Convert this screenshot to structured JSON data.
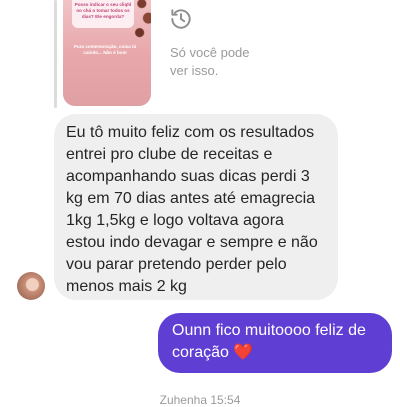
{
  "story_reply": {
    "card_text": "Posso indicar o seu cliqhl no chá o tomar todos os dias? Ele engorda?",
    "overlay_text": "Pura comemoração, coisa tá caindo... Não é bom",
    "view_once_icon": "history-icon",
    "view_once_text": "Só você pode ver isso."
  },
  "incoming_message": {
    "text": "Eu tô muito feliz com os resultados entrei pro clube de receitas e acompanhando suas dicas perdi 3 kg em 70 dias antes até emagrecia 1kg 1,5kg e logo voltava agora estou indo devagar e sempre e não vou parar pretendo perder pelo menos mais 2 kg",
    "bubble_color": "#efefef"
  },
  "outgoing_message": {
    "text": "Ounn fico muitoooo feliz de coração",
    "emoji": "❤️",
    "bubble_color": "#5f3fd3"
  },
  "timestamp": "Zuhenha 15:54"
}
